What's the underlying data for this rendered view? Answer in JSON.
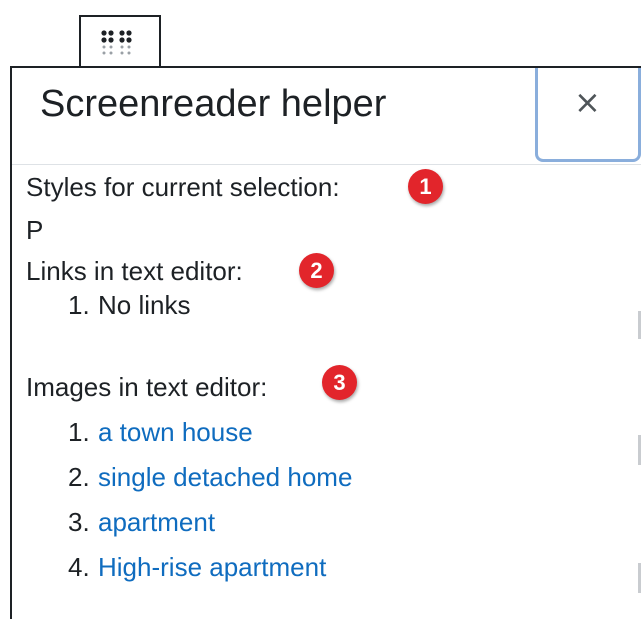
{
  "dialog": {
    "title": "Screenreader helper",
    "close_label": "×"
  },
  "sections": {
    "styles": {
      "label": "Styles for current selection:",
      "badge": "1",
      "value": "P"
    },
    "links": {
      "label": "Links in text editor:",
      "badge": "2",
      "items": [
        {
          "num": "1.",
          "text": "No links"
        }
      ]
    },
    "images": {
      "label": "Images in text editor:",
      "badge": "3",
      "items": [
        {
          "num": "1.",
          "text": "a town house"
        },
        {
          "num": "2.",
          "text": "single detached home"
        },
        {
          "num": "3.",
          "text": "apartment"
        },
        {
          "num": "4.",
          "text": "High-rise apartment"
        }
      ]
    }
  },
  "colors": {
    "badge": "#e2252b",
    "link": "#0f6cbf",
    "close_focus_ring": "#8aaedc"
  },
  "icons": {
    "toolbar": "grip-dots-icon",
    "close": "close-icon"
  }
}
